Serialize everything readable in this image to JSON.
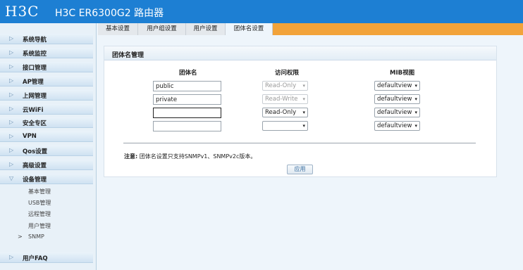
{
  "header": {
    "logo": "H3C",
    "title": "H3C ER6300G2 路由器"
  },
  "sidebar": {
    "items": [
      {
        "label": "系统导航",
        "arrow": "▷"
      },
      {
        "label": "系统监控",
        "arrow": "▷"
      },
      {
        "label": "接口管理",
        "arrow": "▷"
      },
      {
        "label": "AP管理",
        "arrow": "▷"
      },
      {
        "label": "上网管理",
        "arrow": "▷"
      },
      {
        "label": "云WiFi",
        "arrow": "▷"
      },
      {
        "label": "安全专区",
        "arrow": "▷"
      },
      {
        "label": "VPN",
        "arrow": "▷"
      },
      {
        "label": "Qos设置",
        "arrow": "▷"
      },
      {
        "label": "高级设置",
        "arrow": "▷"
      },
      {
        "label": "设备管理",
        "arrow": "▽"
      },
      {
        "label": "用户FAQ",
        "arrow": "▷"
      }
    ],
    "subitems": [
      "基本管理",
      "USB管理",
      "远程管理",
      "用户管理",
      "SNMP"
    ],
    "active_marker": ">"
  },
  "tabs": [
    "基本设置",
    "用户组设置",
    "用户设置",
    "团体名设置"
  ],
  "panel": {
    "title": "团体名管理",
    "columns": [
      "团体名",
      "访问权限",
      "MIB视图"
    ],
    "rows": [
      {
        "name": "public",
        "access": "Read-Only",
        "mib": "defaultview"
      },
      {
        "name": "private",
        "access": "Read-Write",
        "mib": "defaultview"
      },
      {
        "name": "",
        "access": "Read-Only",
        "mib": "defaultview"
      },
      {
        "name": "",
        "access": "",
        "mib": "defaultview"
      }
    ],
    "note_label": "注意:",
    "note_text": "团体名设置只支持SNMPv1、SNMPv2c版本。",
    "apply_label": "应用"
  },
  "icons": {
    "select_chevron": "chevron-down-icon",
    "nav_arrow": "triangle-right-icon"
  }
}
